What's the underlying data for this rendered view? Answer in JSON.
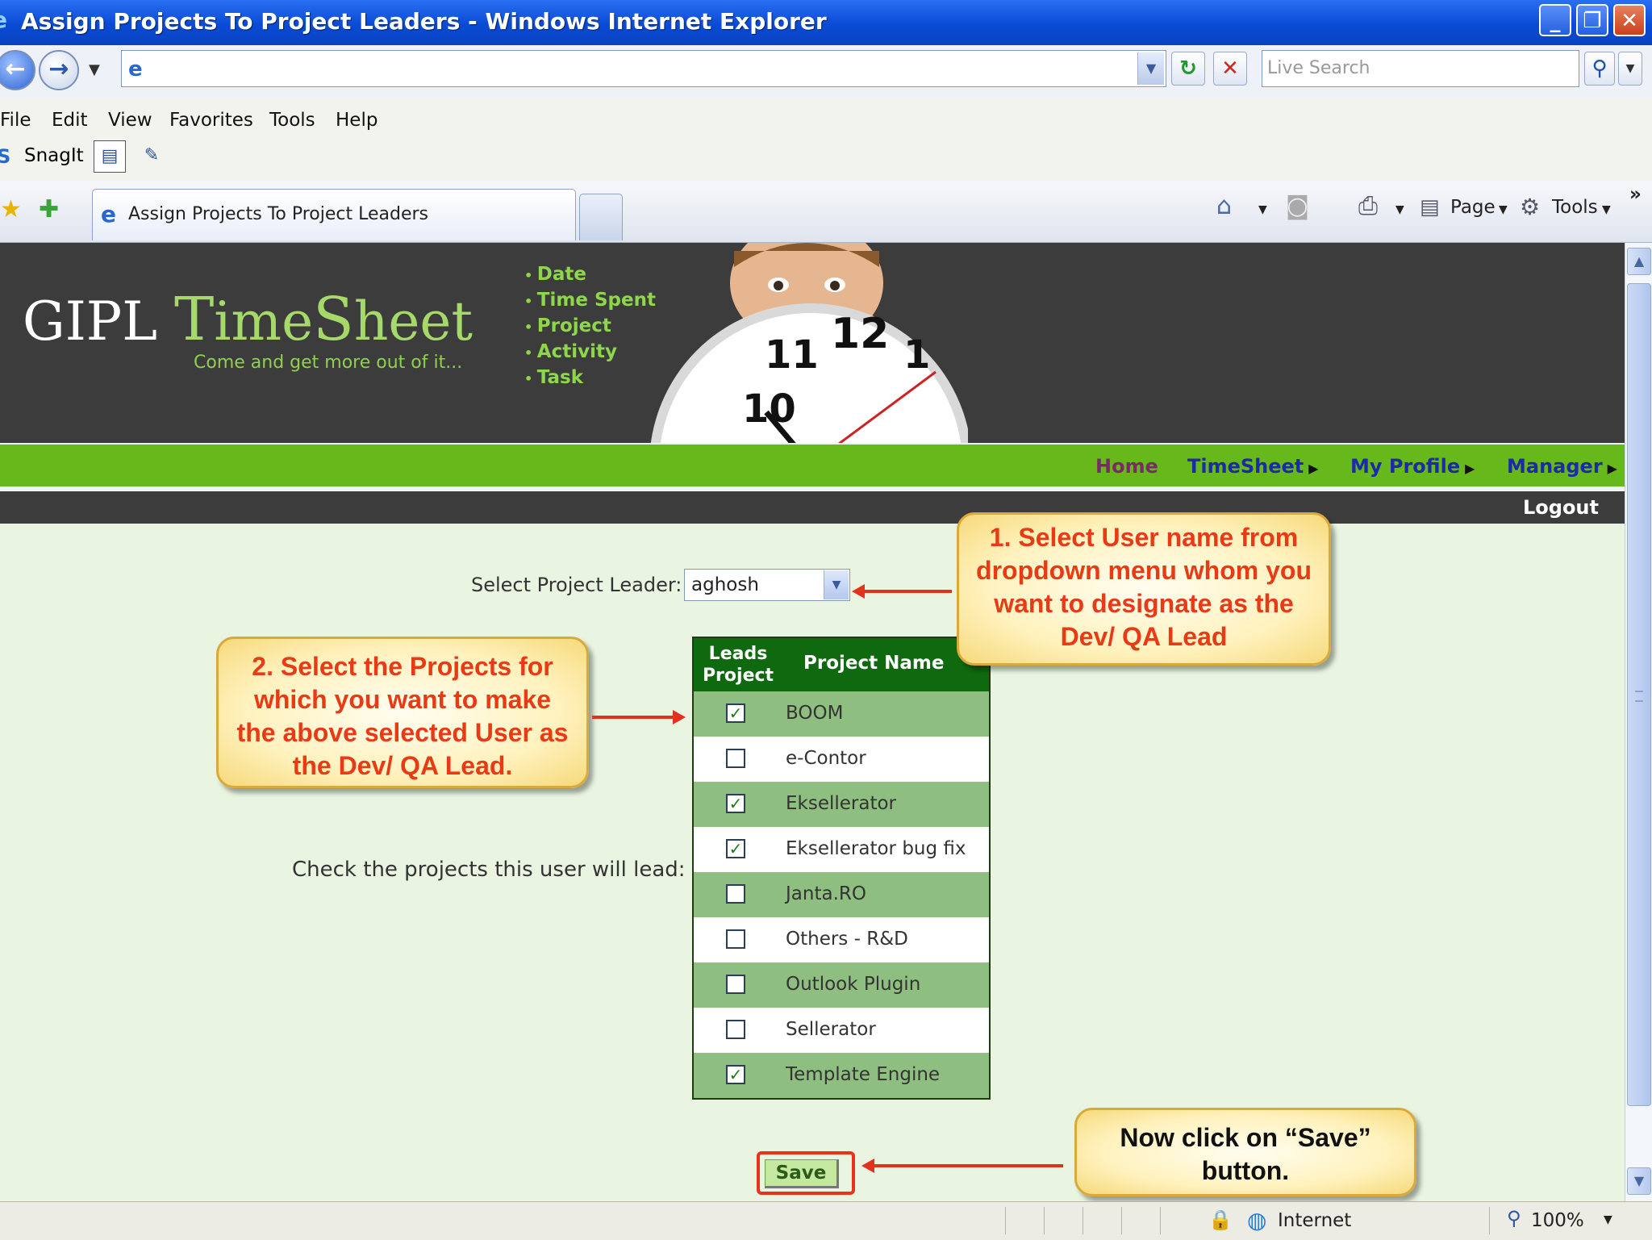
{
  "window": {
    "title": "Assign Projects To Project Leaders - Windows Internet Explorer"
  },
  "address_bar": {
    "url": "",
    "search_placeholder": "Live Search"
  },
  "menu": [
    "File",
    "Edit",
    "View",
    "Favorites",
    "Tools",
    "Help"
  ],
  "toolbar": {
    "snagit_label": "SnagIt"
  },
  "tab": {
    "label": "Assign Projects To Project Leaders"
  },
  "commands": {
    "page_label": "Page",
    "tools_label": "Tools"
  },
  "site": {
    "logo_prefix": "GIPL ",
    "logo_time": "T",
    "logo_ime": "ime",
    "logo_s": "S",
    "logo_heet": "heet",
    "tagline": "Come and get more out of it...",
    "bullets": [
      "Date",
      "Time Spent",
      "Project",
      "Activity",
      "Task"
    ]
  },
  "nav": {
    "home": "Home",
    "timesheet": "TimeSheet",
    "my_profile": "My Profile",
    "manager": "Manager",
    "logout": "Logout"
  },
  "form": {
    "select_label": "Select Project Leader:",
    "selected_leader": "aghosh",
    "check_label": "Check the projects this user will lead:",
    "table_header_leads": "Leads Project",
    "table_header_name": "Project Name",
    "projects": [
      {
        "name": "BOOM",
        "checked": true
      },
      {
        "name": "e-Contor",
        "checked": false
      },
      {
        "name": "Eksellerator",
        "checked": true
      },
      {
        "name": "Eksellerator bug fix",
        "checked": true
      },
      {
        "name": "Janta.RO",
        "checked": false
      },
      {
        "name": "Others - R&D",
        "checked": false
      },
      {
        "name": "Outlook Plugin",
        "checked": false
      },
      {
        "name": "Sellerator",
        "checked": false
      },
      {
        "name": "Template Engine",
        "checked": true
      }
    ],
    "save_label": "Save"
  },
  "callouts": {
    "step1": "1. Select User name from dropdown menu whom you want to designate as the Dev/ QA Lead",
    "step2": "2. Select the Projects for which you want to make the above selected User as the Dev/ QA Lead.",
    "step3": "Now click on “Save” button."
  },
  "status": {
    "zone": "Internet",
    "zoom": "100%"
  },
  "colors": {
    "accent_green": "#67b81a",
    "callout_red": "#e83a14",
    "header_green": "#0f6a0f"
  }
}
